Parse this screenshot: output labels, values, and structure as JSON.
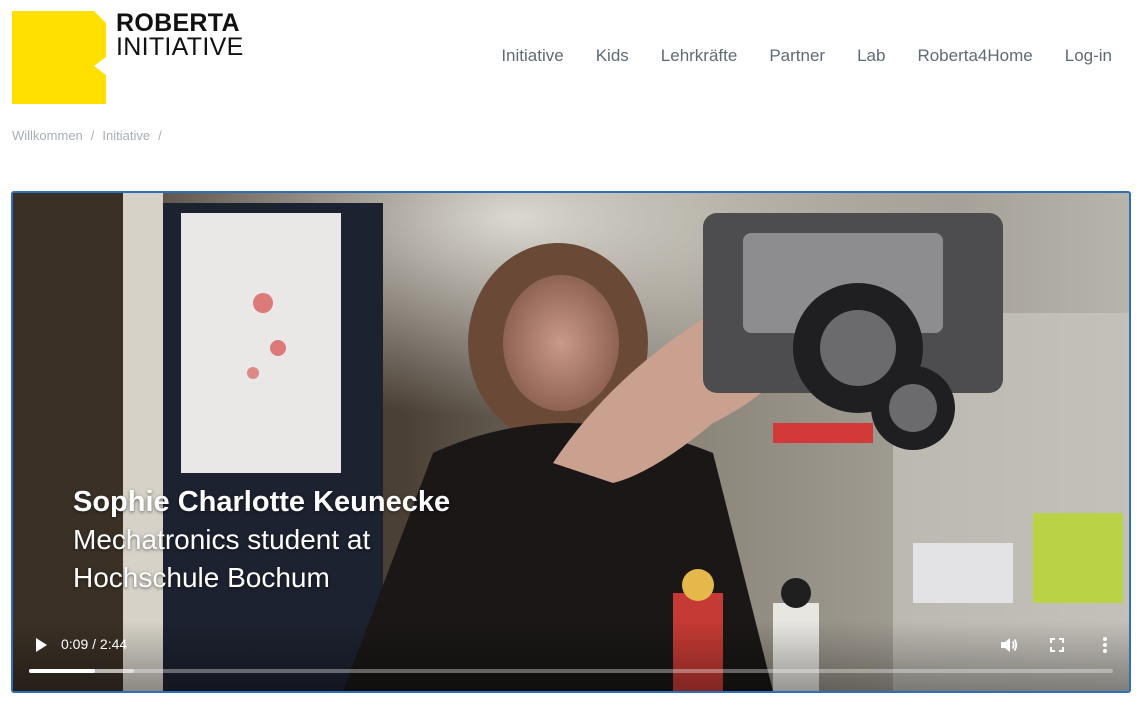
{
  "brand": {
    "line1": "ROBERTA",
    "line2": "INITIATIVE",
    "logo_color": "#ffe000"
  },
  "nav": {
    "items": [
      {
        "label": "Initiative"
      },
      {
        "label": "Kids"
      },
      {
        "label": "Lehrkräfte"
      },
      {
        "label": "Partner"
      },
      {
        "label": "Lab"
      },
      {
        "label": "Roberta4Home"
      },
      {
        "label": "Log-in"
      }
    ]
  },
  "breadcrumb": {
    "items": [
      {
        "label": "Willkommen"
      },
      {
        "label": "Initiative"
      }
    ],
    "separator": "/"
  },
  "video": {
    "caption_name": "Sophie Charlotte Keunecke",
    "caption_role_line1": "Mechatronics student at",
    "caption_role_line2": "Hochschule Bochum",
    "current_time": "0:09",
    "duration": "2:44",
    "time_display": "0:09 / 2:44",
    "played_fraction": 0.061,
    "buffered_fraction": 0.097,
    "border_color": "#2f6fb8",
    "icons": [
      "play-icon",
      "volume-icon",
      "fullscreen-icon",
      "more-options-icon"
    ]
  }
}
